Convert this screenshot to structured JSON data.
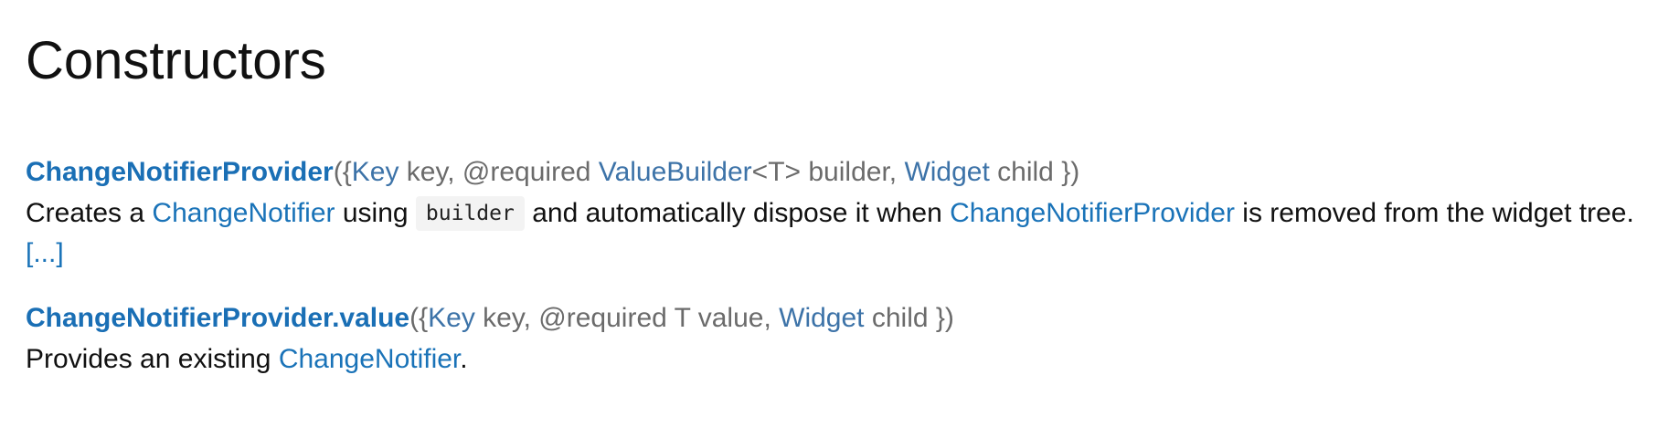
{
  "heading": "Constructors",
  "constructors": [
    {
      "name": "ChangeNotifierProvider",
      "signature": {
        "open": "({",
        "param1_type": "Key",
        "param1_rest": " key, @required ",
        "param2_type": "ValueBuilder",
        "param2_rest": "<T> builder, ",
        "param3_type": "Widget",
        "param3_rest": " child })"
      },
      "description": {
        "text1": "Creates a ",
        "link1": "ChangeNotifier",
        "text2": " using ",
        "code": "builder",
        "text3": " and automatically dispose it when ",
        "link2": "ChangeNotifierProvider",
        "text4": " is removed from the widget tree. ",
        "more": "[...]"
      }
    },
    {
      "name": "ChangeNotifierProvider.value",
      "signature": {
        "open": "({",
        "param1_type": "Key",
        "param1_rest": " key, @required T value, ",
        "param2_type": "Widget",
        "param2_rest": " child })"
      },
      "description": {
        "text1": "Provides an existing ",
        "link1": "ChangeNotifier",
        "text2": "."
      }
    }
  ]
}
